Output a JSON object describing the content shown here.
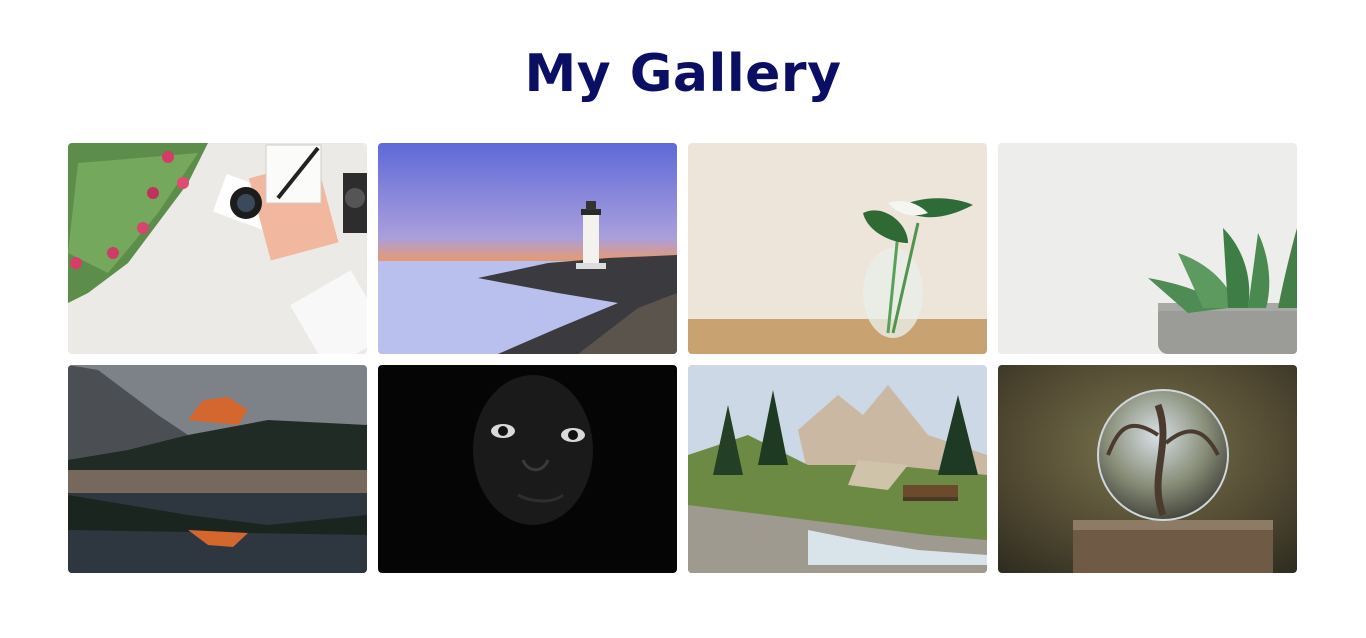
{
  "page": {
    "title": "My Gallery"
  },
  "gallery": {
    "images": [
      {
        "subject": "flatlay-desk-tulips-camera"
      },
      {
        "subject": "lighthouse-at-sunset"
      },
      {
        "subject": "plant-in-glass-vase"
      },
      {
        "subject": "succulent-in-pot"
      },
      {
        "subject": "mountain-lake-reflection"
      },
      {
        "subject": "dark-portrait-face"
      },
      {
        "subject": "alpine-stream-landscape"
      },
      {
        "subject": "crystal-ball-on-stump"
      }
    ]
  },
  "colors": {
    "title": "#0b0f63",
    "background": "#ffffff"
  }
}
